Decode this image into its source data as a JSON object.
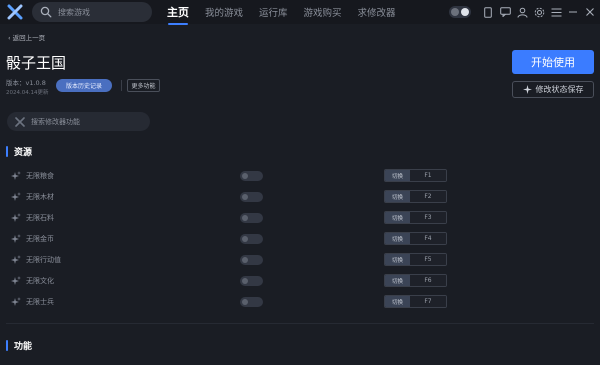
{
  "header": {
    "search_placeholder": "搜索游戏",
    "tabs": [
      {
        "label": "主页",
        "active": true
      },
      {
        "label": "我的游戏"
      },
      {
        "label": "运行库"
      },
      {
        "label": "游戏购买"
      },
      {
        "label": "求修改器"
      }
    ]
  },
  "game": {
    "back_label": "返回上一页",
    "title": "骰子王国",
    "version": "版本：v1.0.8",
    "date": "2024.04.14更新",
    "history_button": "版本历史记录",
    "more_button": "更多功能"
  },
  "actions": {
    "start_label": "开始使用",
    "save_label": "修改状态保存"
  },
  "mod_search_placeholder": "搜索修改器功能",
  "sections": {
    "resources": "资源",
    "functions": "功能"
  },
  "switch_label": "切换",
  "cheats": [
    {
      "label": "无限粮食",
      "key": "F1"
    },
    {
      "label": "无限木材",
      "key": "F2"
    },
    {
      "label": "无限石料",
      "key": "F3"
    },
    {
      "label": "无限金币",
      "key": "F4"
    },
    {
      "label": "无限行动值",
      "key": "F5"
    },
    {
      "label": "无限文化",
      "key": "F6"
    },
    {
      "label": "无限士兵",
      "key": "F7"
    }
  ],
  "colors": {
    "accent": "#3b7cff",
    "background": "#1a1d24"
  }
}
